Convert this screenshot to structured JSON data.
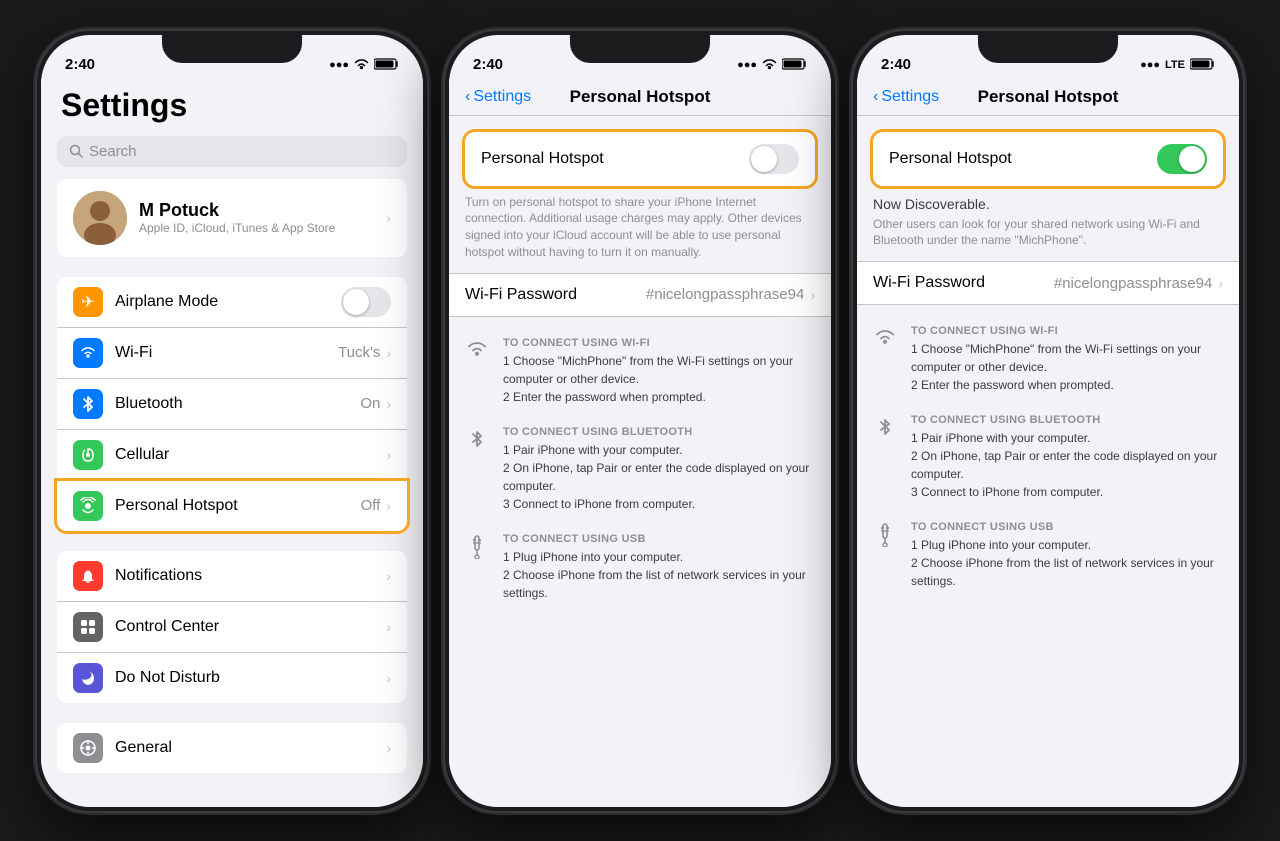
{
  "phone1": {
    "status": {
      "time": "2:40",
      "signal": "●●●",
      "wifi": "WiFi",
      "battery": "🔋"
    },
    "title": "Settings",
    "search": {
      "placeholder": "Search"
    },
    "profile": {
      "name": "M Potuck",
      "subtitle": "Apple ID, iCloud, iTunes & App Store"
    },
    "cells": [
      {
        "label": "Airplane Mode",
        "value": "",
        "icon_bg": "#ff9500",
        "icon": "✈"
      },
      {
        "label": "Wi-Fi",
        "value": "Tuck's",
        "icon_bg": "#007aff",
        "icon": "📶"
      },
      {
        "label": "Bluetooth",
        "value": "On",
        "icon_bg": "#007aff",
        "icon": "❄"
      },
      {
        "label": "Cellular",
        "value": "",
        "icon_bg": "#34c759",
        "icon": "📡"
      },
      {
        "label": "Personal Hotspot",
        "value": "Off",
        "icon_bg": "#34c759",
        "icon": "⬡",
        "highlighted": true
      }
    ],
    "cells2": [
      {
        "label": "Notifications",
        "value": "",
        "icon_bg": "#ff3b30",
        "icon": "🔔"
      },
      {
        "label": "Control Center",
        "value": "",
        "icon_bg": "#636366",
        "icon": "⊞"
      },
      {
        "label": "Do Not Disturb",
        "value": "",
        "icon_bg": "#5856d6",
        "icon": "🌙"
      }
    ],
    "cells3": [
      {
        "label": "General",
        "value": "",
        "icon_bg": "#8e8e93",
        "icon": "⚙"
      }
    ]
  },
  "phone2": {
    "status": {
      "time": "2:40"
    },
    "nav": {
      "back": "Settings",
      "title": "Personal Hotspot"
    },
    "toggle_label": "Personal Hotspot",
    "toggle_state": "off",
    "description": "Turn on personal hotspot to share your iPhone Internet connection. Additional usage charges may apply. Other devices signed into your iCloud account will be able to use personal hotspot without having to turn it on manually.",
    "wifi_password": {
      "label": "Wi-Fi Password",
      "value": "#nicelongpassphrase94"
    },
    "connect_items": [
      {
        "icon": "wifi",
        "heading": "TO CONNECT USING WI-FI",
        "steps": "1 Choose \"MichPhone\" from the Wi-Fi settings on your computer or other device.\n2 Enter the password when prompted."
      },
      {
        "icon": "bluetooth",
        "heading": "TO CONNECT USING BLUETOOTH",
        "steps": "1 Pair iPhone with your computer.\n2 On iPhone, tap Pair or enter the code displayed on your computer.\n3 Connect to iPhone from computer."
      },
      {
        "icon": "usb",
        "heading": "TO CONNECT USING USB",
        "steps": "1 Plug iPhone into your computer.\n2 Choose iPhone from the list of network services in your settings."
      }
    ]
  },
  "phone3": {
    "status": {
      "time": "2:40",
      "carrier": "LTE"
    },
    "nav": {
      "back": "Settings",
      "title": "Personal Hotspot"
    },
    "toggle_label": "Personal Hotspot",
    "toggle_state": "on",
    "discoverable": "Now Discoverable.",
    "discoverable_sub": "Other users can look for your shared network using Wi-Fi and Bluetooth under the name \"MichPhone\".",
    "wifi_password": {
      "label": "Wi-Fi Password",
      "value": "#nicelongpassphrase94"
    },
    "connect_items": [
      {
        "icon": "wifi",
        "heading": "TO CONNECT USING WI-FI",
        "steps": "1 Choose \"MichPhone\" from the Wi-Fi settings on your computer or other device.\n2 Enter the password when prompted."
      },
      {
        "icon": "bluetooth",
        "heading": "TO CONNECT USING BLUETOOTH",
        "steps": "1 Pair iPhone with your computer.\n2 On iPhone, tap Pair or enter the code displayed on your computer.\n3 Connect to iPhone from computer."
      },
      {
        "icon": "usb",
        "heading": "TO CONNECT USING USB",
        "steps": "1 Plug iPhone into your computer.\n2 Choose iPhone from the list of network services in your settings."
      }
    ]
  },
  "icons": {
    "wifi": "📶",
    "bluetooth": "✳",
    "usb": "⌁"
  }
}
